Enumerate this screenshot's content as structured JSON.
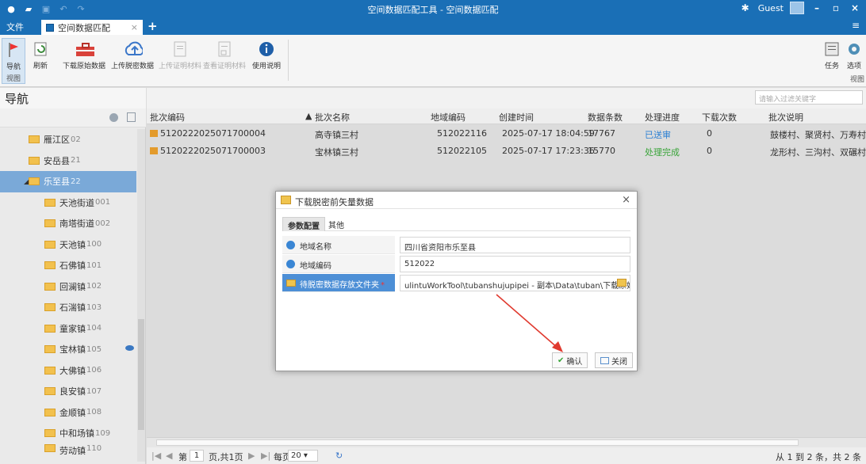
{
  "app": {
    "window_title": "空间数据匹配工具 - 空间数据匹配",
    "user": "Guest"
  },
  "menu": {
    "file": "文件"
  },
  "tabs": [
    {
      "label": "空间数据匹配"
    }
  ],
  "ribbon": {
    "nav": {
      "label": "导航",
      "group": "视图"
    },
    "refresh": "刷新",
    "download": "下载原始数据",
    "upload": "上传脱密数据",
    "upload_proof": "上传证明材料",
    "view_proof": "查看证明材料",
    "help": "使用说明",
    "task": "任务",
    "options": "选项",
    "group_view": "视图"
  },
  "nav_panel": {
    "title": "导航",
    "items": [
      {
        "name": "雁江区",
        "code": "02"
      },
      {
        "name": "安岳县",
        "code": "21"
      },
      {
        "name": "乐至县",
        "code": "22"
      },
      {
        "name": "天池街道",
        "code": "001"
      },
      {
        "name": "南塔街道",
        "code": "002"
      },
      {
        "name": "天池镇",
        "code": "100"
      },
      {
        "name": "石佛镇",
        "code": "101"
      },
      {
        "name": "回澜镇",
        "code": "102"
      },
      {
        "name": "石湍镇",
        "code": "103"
      },
      {
        "name": "童家镇",
        "code": "104"
      },
      {
        "name": "宝林镇",
        "code": "105"
      },
      {
        "name": "大佛镇",
        "code": "106"
      },
      {
        "name": "良安镇",
        "code": "107"
      },
      {
        "name": "金顺镇",
        "code": "108"
      },
      {
        "name": "中和场镇",
        "code": "109"
      },
      {
        "name": "劳动镇",
        "code": "110"
      }
    ]
  },
  "grid": {
    "filter_placeholder": "请输入过滤关键字",
    "columns": [
      "批次编码",
      "批次名称",
      "地域编码",
      "创建时间",
      "数据条数",
      "处理进度",
      "下载次数",
      "批次说明"
    ],
    "rows": [
      {
        "code": "5120222025071700004",
        "name": "高寺镇三村",
        "region": "512022116",
        "created": "2025-07-17 18:04:59",
        "count": "17767",
        "status": "已送审",
        "downloads": "0",
        "desc": "鼓楼村、聚贤村、万寿村"
      },
      {
        "code": "5120222025071700003",
        "name": "宝林镇三村",
        "region": "512022105",
        "created": "2025-07-17 17:23:36",
        "count": "15770",
        "status": "处理完成",
        "downloads": "0",
        "desc": "龙形村、三沟村、双碾村"
      }
    ]
  },
  "pager": {
    "page_label": "第",
    "page": "1",
    "total_label": "页,共1页",
    "per_page_label": "每页",
    "per_page": "20",
    "summary": "从 1 到 2 条，共 2 条"
  },
  "dialog": {
    "title": "下载脱密前矢量数据",
    "close": "×",
    "tabs": [
      "参数配置",
      "其他"
    ],
    "fields": [
      {
        "label": "地域名称",
        "value": "四川省资阳市乐至县"
      },
      {
        "label": "地域编码",
        "value": "512022"
      },
      {
        "label": "待脱密数据存放文件夹",
        "required": "*",
        "value": "ulintuWorkTool\\tubanshujupipei - 副本\\Data\\tuban\\下载原始"
      }
    ],
    "ok": "确认",
    "cancel": "关闭"
  },
  "colors": {
    "title_bar": "#1a6fb6",
    "selected_tree": "#7aa9d8",
    "status_sent": "#2a7fd3",
    "status_done": "#3aa43a",
    "arrow": "#e03a2f"
  }
}
